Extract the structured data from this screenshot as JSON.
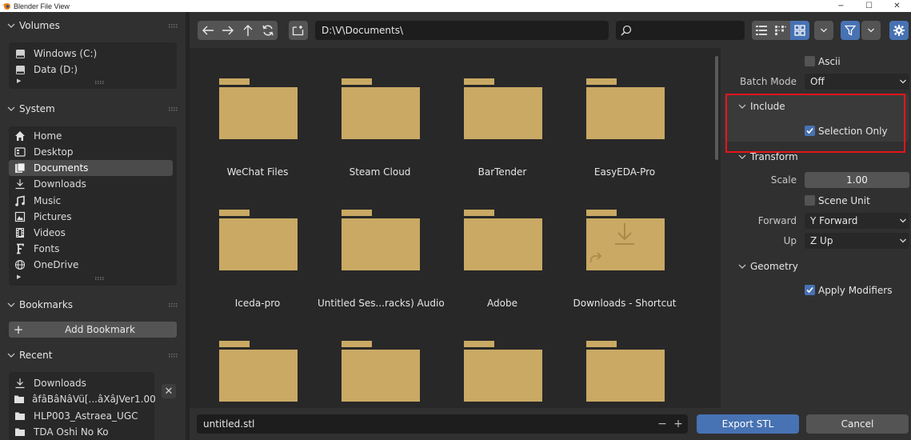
{
  "window": {
    "title": "Blender File View",
    "minimize": "−",
    "maximize": "☐",
    "close": "✕"
  },
  "sidebar": {
    "volumes": {
      "title": "Volumes",
      "items": [
        {
          "label": "Windows (C:)",
          "icon": "drive-icon"
        },
        {
          "label": "Data (D:)",
          "icon": "drive-icon"
        }
      ]
    },
    "system": {
      "title": "System",
      "items": [
        {
          "label": "Home",
          "icon": "home-icon"
        },
        {
          "label": "Desktop",
          "icon": "desktop-icon"
        },
        {
          "label": "Documents",
          "icon": "documents-icon",
          "active": true
        },
        {
          "label": "Downloads",
          "icon": "download-icon"
        },
        {
          "label": "Music",
          "icon": "music-icon"
        },
        {
          "label": "Pictures",
          "icon": "pictures-icon"
        },
        {
          "label": "Videos",
          "icon": "videos-icon"
        },
        {
          "label": "Fonts",
          "icon": "fonts-icon"
        },
        {
          "label": "OneDrive",
          "icon": "globe-icon"
        }
      ]
    },
    "bookmarks": {
      "title": "Bookmarks",
      "add_label": "Add Bookmark",
      "add_icon": "+"
    },
    "recent": {
      "title": "Recent",
      "remove_icon": "✕",
      "items": [
        {
          "label": "Downloads",
          "icon": "download-icon"
        },
        {
          "label": "âfâBâNâVü[...âXâJVer1.00",
          "icon": "folder-icon"
        },
        {
          "label": "HLP003_Astraea_UGC",
          "icon": "folder-icon"
        },
        {
          "label": "TDA Oshi No Ko",
          "icon": "folder-icon"
        }
      ]
    }
  },
  "toolbar": {
    "path": "D:\\V\\Documents\\",
    "search_value": ""
  },
  "files": [
    {
      "label": "WeChat Files",
      "type": "folder"
    },
    {
      "label": "Steam Cloud",
      "type": "folder"
    },
    {
      "label": "BarTender",
      "type": "folder"
    },
    {
      "label": "EasyEDA-Pro",
      "type": "folder"
    },
    {
      "label": "Iceda-pro",
      "type": "folder"
    },
    {
      "label": "Untitled Ses...racks) Audio",
      "type": "folder"
    },
    {
      "label": "Adobe",
      "type": "folder"
    },
    {
      "label": "Downloads - Shortcut",
      "type": "shortcut"
    },
    {
      "label": "",
      "type": "folder"
    },
    {
      "label": "",
      "type": "folder"
    },
    {
      "label": "",
      "type": "folder"
    },
    {
      "label": "",
      "type": "folder"
    }
  ],
  "bottom": {
    "filename": "untitled.stl",
    "minus": "−",
    "plus": "+",
    "export_label": "Export STL",
    "cancel_label": "Cancel"
  },
  "properties": {
    "ascii_label": "Ascii",
    "ascii_checked": false,
    "batch_mode_label": "Batch Mode",
    "batch_mode_value": "Off",
    "include": {
      "title": "Include",
      "selection_only_label": "Selection Only",
      "selection_only_checked": true
    },
    "transform": {
      "title": "Transform",
      "scale_label": "Scale",
      "scale_value": "1.00",
      "scene_unit_label": "Scene Unit",
      "scene_unit_checked": false,
      "forward_label": "Forward",
      "forward_value": "Y Forward",
      "up_label": "Up",
      "up_value": "Z Up"
    },
    "geometry": {
      "title": "Geometry",
      "apply_modifiers_label": "Apply Modifiers",
      "apply_modifiers_checked": true
    }
  },
  "colors": {
    "folder": "#c9a964",
    "accent": "#4772b3",
    "highlight": "#e8141b"
  }
}
